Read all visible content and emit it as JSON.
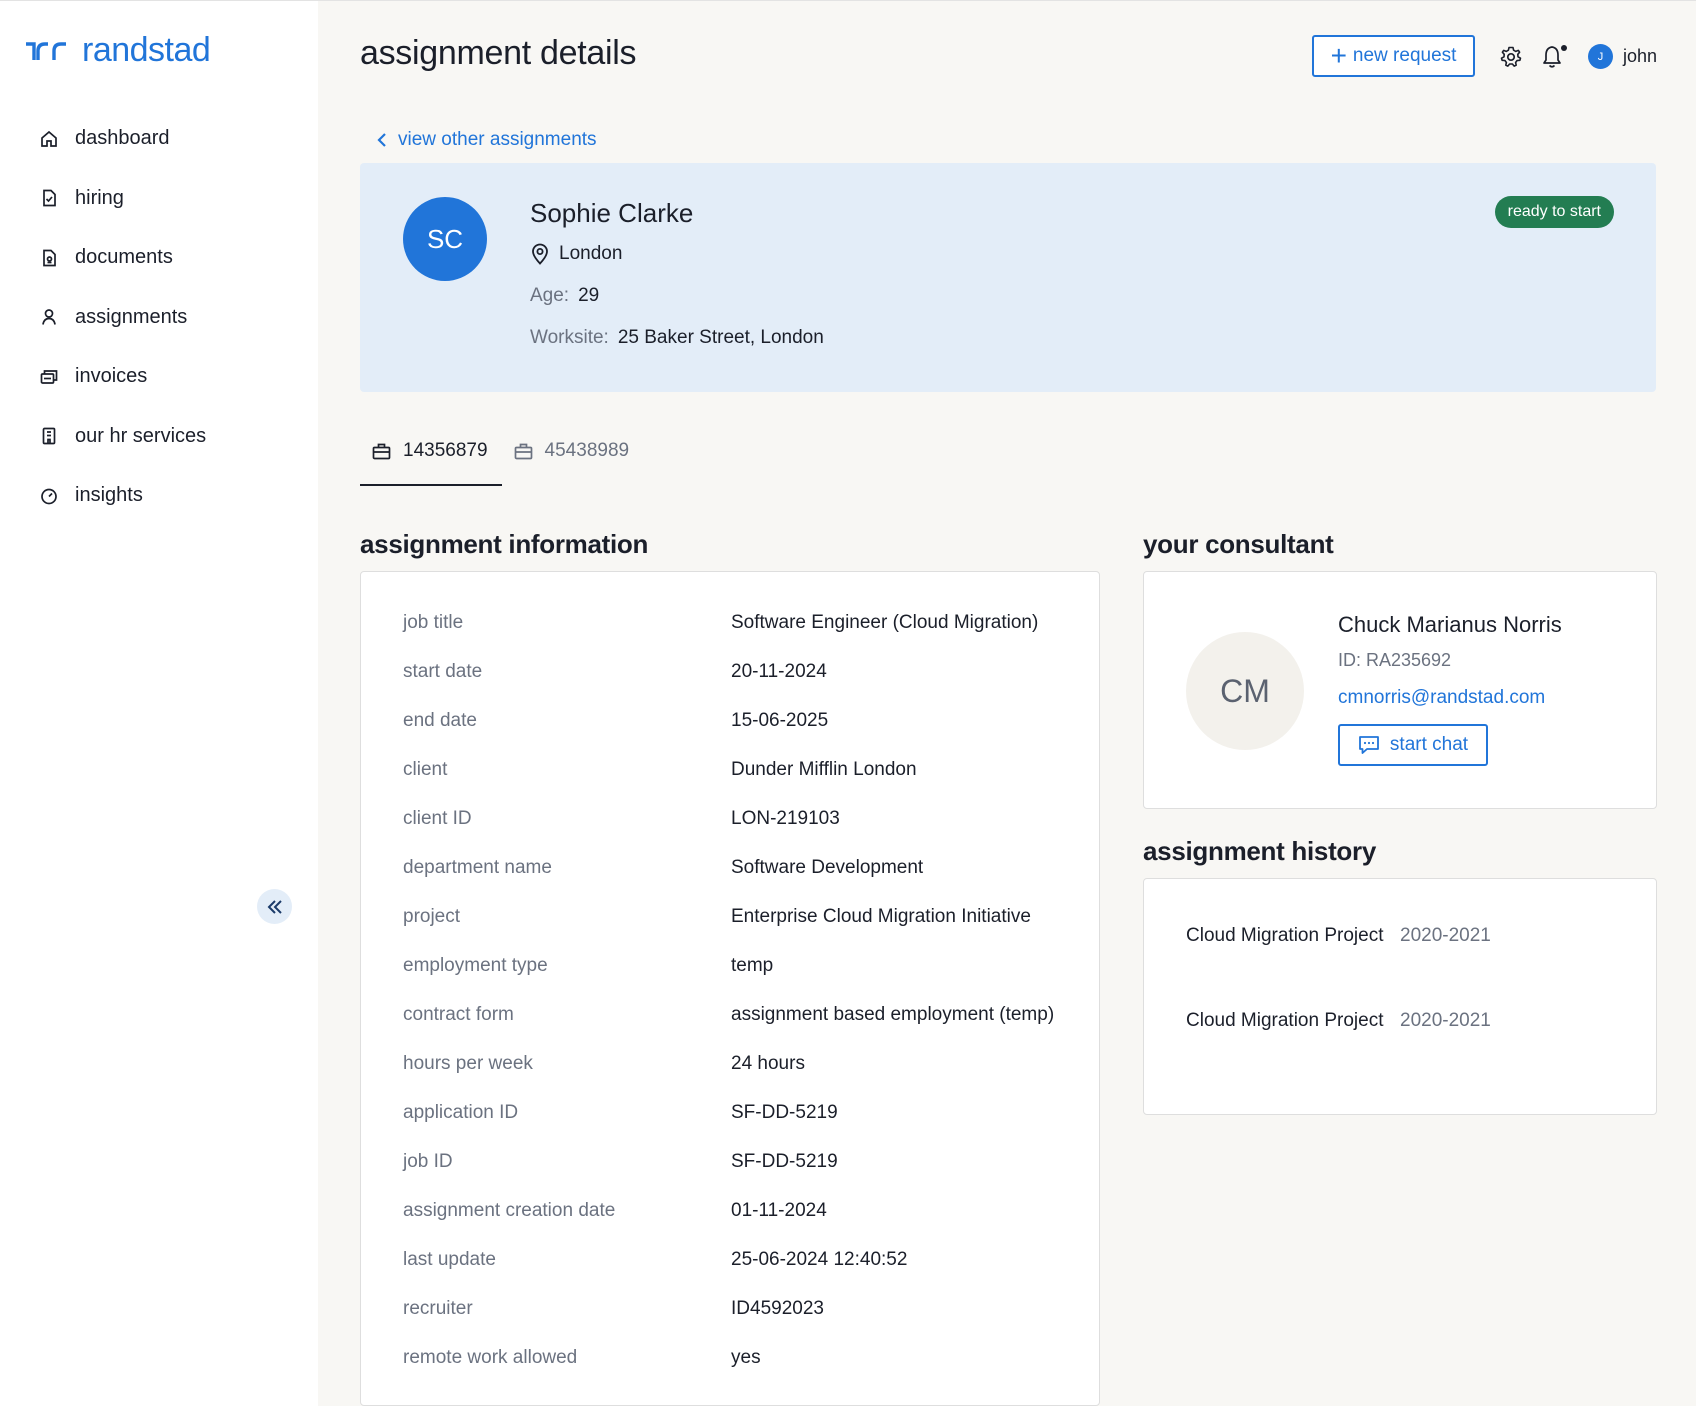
{
  "brand": {
    "name": "randstad",
    "color": "#2175d9"
  },
  "sidebar": {
    "items": [
      {
        "label": "dashboard",
        "icon": "home-icon"
      },
      {
        "label": "hiring",
        "icon": "document-check-icon"
      },
      {
        "label": "documents",
        "icon": "document-icon"
      },
      {
        "label": "assignments",
        "icon": "person-icon"
      },
      {
        "label": "invoices",
        "icon": "invoice-icon"
      },
      {
        "label": "our hr services",
        "icon": "building-icon"
      },
      {
        "label": "insights",
        "icon": "gauge-icon"
      }
    ],
    "collapse_icon": "double-chevron-left-icon"
  },
  "header": {
    "title": "assignment details",
    "new_request_label": "new request",
    "user_initial": "J",
    "user_name": "john"
  },
  "back_link": "view other assignments",
  "profile": {
    "initials": "SC",
    "name": "Sophie Clarke",
    "location": "London",
    "age_label": "Age:",
    "age": "29",
    "worksite_label": "Worksite:",
    "worksite": "25 Baker Street, London",
    "status": "ready to start",
    "status_color": "#237d52"
  },
  "tabs": [
    {
      "label": "14356879",
      "active": true
    },
    {
      "label": "45438989",
      "active": false
    }
  ],
  "assignment_info": {
    "title": "assignment information",
    "rows": [
      {
        "key": "job title",
        "value": "Software Engineer (Cloud Migration)"
      },
      {
        "key": "start date",
        "value": "20-11-2024"
      },
      {
        "key": "end date",
        "value": "15-06-2025"
      },
      {
        "key": "client",
        "value": "Dunder Mifflin London"
      },
      {
        "key": "client ID",
        "value": "LON-219103"
      },
      {
        "key": "department name",
        "value": "Software Development"
      },
      {
        "key": "project",
        "value": "Enterprise Cloud Migration Initiative"
      },
      {
        "key": "employment type",
        "value": "temp"
      },
      {
        "key": "contract form",
        "value": "assignment based employment (temp)"
      },
      {
        "key": "hours per week",
        "value": "24 hours"
      },
      {
        "key": "application ID",
        "value": "SF-DD-5219"
      },
      {
        "key": "job ID",
        "value": "SF-DD-5219"
      },
      {
        "key": "assignment creation date",
        "value": "01-11-2024"
      },
      {
        "key": "last update",
        "value": "25-06-2024 12:40:52"
      },
      {
        "key": "recruiter",
        "value": "ID4592023"
      },
      {
        "key": "remote work allowed",
        "value": "yes"
      }
    ]
  },
  "consultant": {
    "title": "your consultant",
    "initials": "CM",
    "name": "Chuck Marianus Norris",
    "id": "ID: RA235692",
    "email": "cmnorris@randstad.com",
    "chat_label": "start chat"
  },
  "history": {
    "title": "assignment history",
    "items": [
      {
        "name": "Cloud Migration Project",
        "years": "2020-2021"
      },
      {
        "name": "Cloud Migration Project",
        "years": "2020-2021"
      }
    ]
  }
}
